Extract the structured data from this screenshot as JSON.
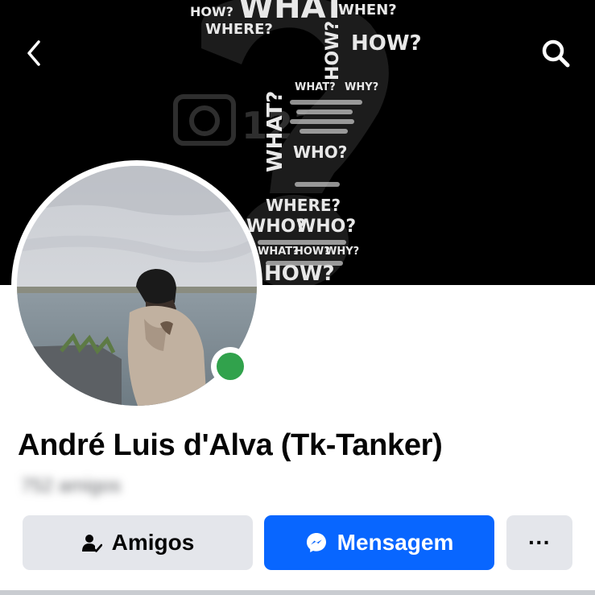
{
  "header": {
    "back_icon": "chevron-left-icon",
    "search_icon": "search-icon"
  },
  "cover": {
    "words": [
      "WHAT",
      "WHEN?",
      "HOW?",
      "WHERE?",
      "HOW?",
      "WHAT?",
      "WHO?",
      "WHY?",
      "WHERE?",
      "HOW?",
      "WHO?",
      "WHAT?",
      "HOW?",
      "WHY?",
      "HOW?"
    ]
  },
  "profile": {
    "name": "André Luis d'Alva (Tk-Tanker)",
    "friends_count": "752 amigos",
    "online": true,
    "colors": {
      "online": "#31a24c"
    }
  },
  "actions": {
    "friends_label": "Amigos",
    "message_label": "Mensagem",
    "more_label": "···",
    "colors": {
      "primary": "#0866ff",
      "secondary": "#e4e6eb"
    }
  }
}
